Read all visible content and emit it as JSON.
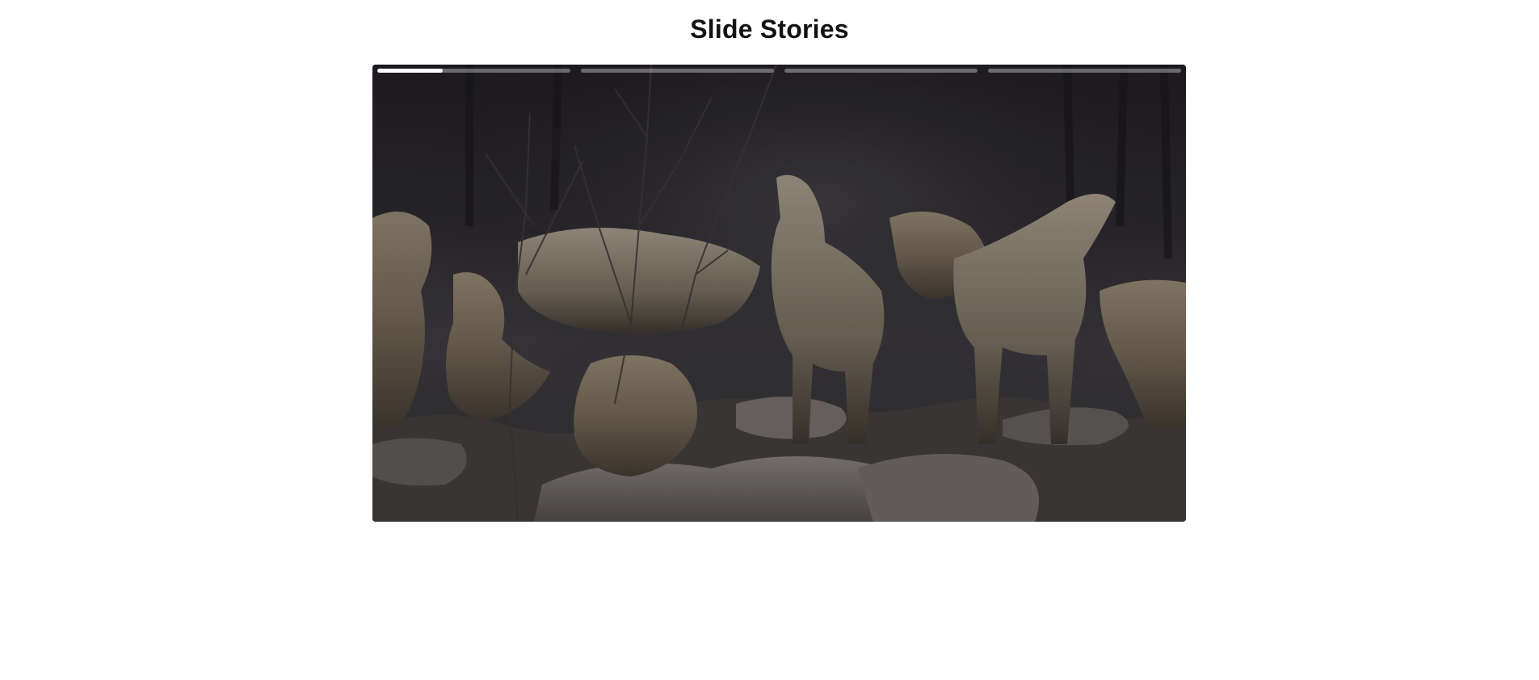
{
  "page": {
    "title": "Slide Stories"
  },
  "story": {
    "slide_count": 4,
    "current_slide": 1,
    "slides": [
      {
        "progress": 0.34,
        "image": "wolf-pack-photo"
      },
      {
        "progress": 0.0
      },
      {
        "progress": 0.0
      },
      {
        "progress": 0.0
      }
    ]
  },
  "colors": {
    "progress_active": "#ffffff",
    "progress_track": "#6b6a6e",
    "title_text": "#111111"
  }
}
